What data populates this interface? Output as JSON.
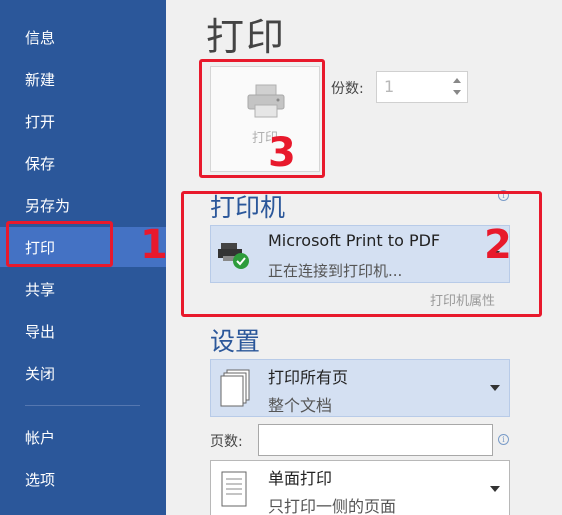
{
  "sidebar": {
    "items": [
      {
        "label": "信息"
      },
      {
        "label": "新建"
      },
      {
        "label": "打开"
      },
      {
        "label": "保存"
      },
      {
        "label": "另存为"
      },
      {
        "label": "打印"
      },
      {
        "label": "共享"
      },
      {
        "label": "导出"
      },
      {
        "label": "关闭"
      },
      {
        "label": "帐户"
      },
      {
        "label": "选项"
      }
    ],
    "active_index": 5,
    "bg_color": "#2b579a"
  },
  "main": {
    "title": "打印",
    "print_button_label": "打印",
    "copies_label": "份数:",
    "copies_value": "1",
    "printer_section_title": "打印机",
    "printer": {
      "name": "Microsoft Print to PDF",
      "status": "正在连接到打印机..."
    },
    "printer_properties_link": "打印机属性",
    "settings_section_title": "设置",
    "print_range": {
      "title": "打印所有页",
      "subtitle": "整个文档"
    },
    "pages_label": "页数:",
    "pages_value": "",
    "sided": {
      "title": "单面打印",
      "subtitle": "只打印一侧的页面"
    },
    "info_icon_glyph": "i"
  },
  "annotations": {
    "num1": "1",
    "num2": "2",
    "num3": "3",
    "color": "#e8192c"
  }
}
